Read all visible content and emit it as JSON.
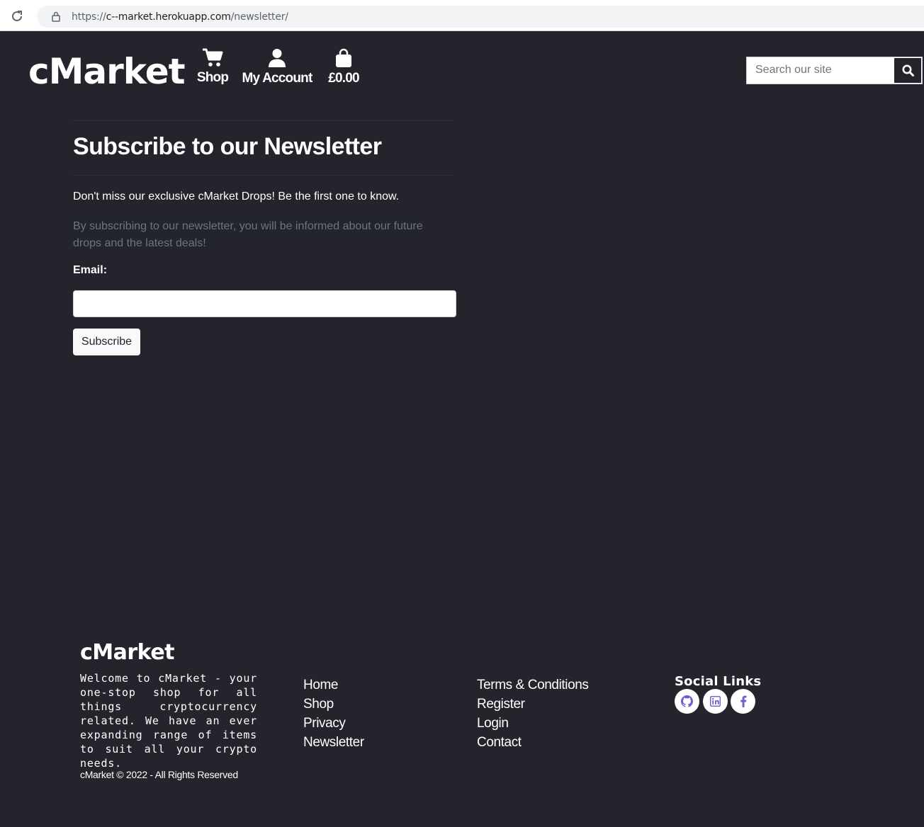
{
  "browser": {
    "url_scheme": "https://",
    "url_host": "c--market.herokuapp.com",
    "url_path": "/newsletter/"
  },
  "header": {
    "logo": "cMarket",
    "nav": {
      "shop": "Shop",
      "account": "My Account",
      "bag_total": "£0.00"
    },
    "search": {
      "placeholder": "Search our site"
    }
  },
  "main": {
    "title": "Subscribe to our Newsletter",
    "lead": "Don't miss our exclusive cMarket Drops! Be the first one to know.",
    "description": "By subscribing to our newsletter, you will be informed about our future drops and the latest deals!",
    "email_label": "Email:",
    "email_value": "",
    "subscribe_label": "Subscribe"
  },
  "footer": {
    "logo": "cMarket",
    "about": "Welcome to cMarket - your one-stop shop for all things cryptocurrency related. We have an ever expanding range of items to suit all your crypto needs.",
    "copyright": "cMarket © 2022 - All Rights Reserved",
    "links_col1": [
      "Home",
      "Shop",
      "Privacy",
      "Newsletter"
    ],
    "links_col2": [
      "Terms & Conditions",
      "Register",
      "Login",
      "Contact"
    ],
    "social_title": "Social Links",
    "social_icons": [
      "github-icon",
      "linkedin-icon",
      "facebook-icon"
    ]
  },
  "colors": {
    "background": "#24252c",
    "text": "#ffffff",
    "muted_text": "#6c757d",
    "social_icon": "#6e5fd0"
  }
}
